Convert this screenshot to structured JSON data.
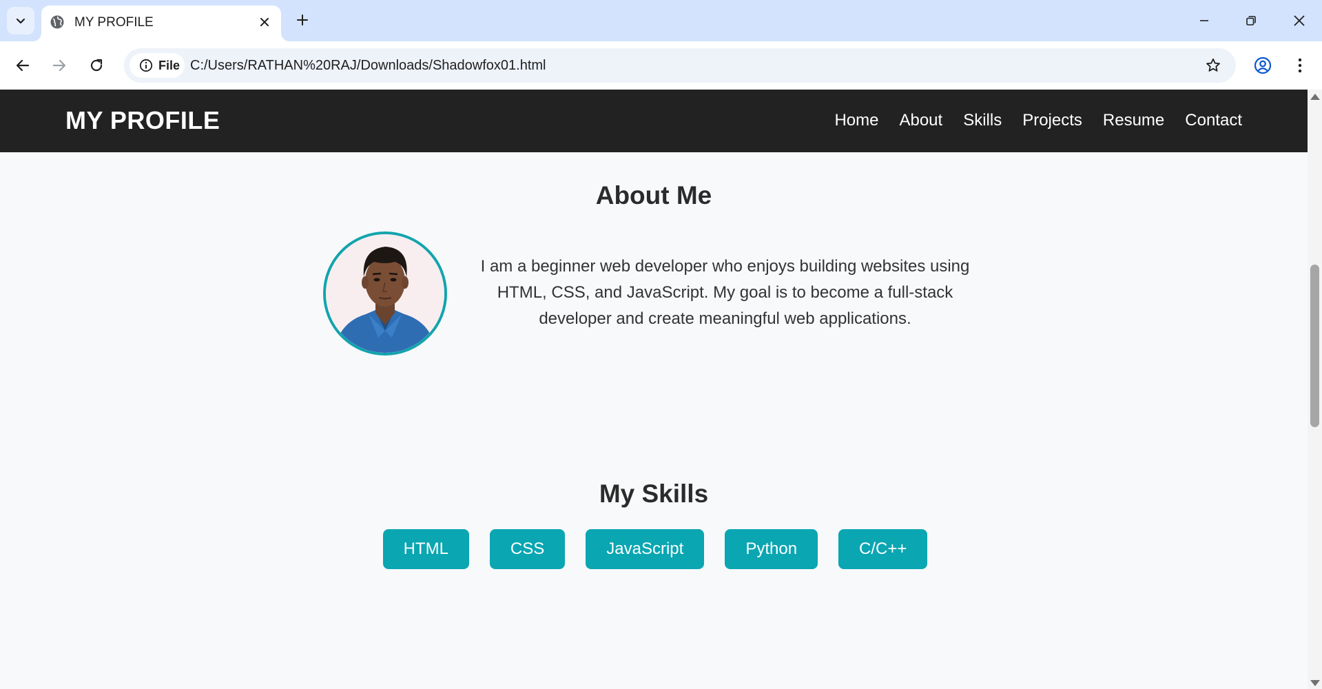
{
  "browser": {
    "tab_title": "MY PROFILE",
    "chip_label": "File",
    "url": "C:/Users/RATHAN%20RAJ/Downloads/Shadowfox01.html",
    "icons": [
      "tab-list-icon",
      "globe-icon",
      "close-icon",
      "plus-icon",
      "minimize-icon",
      "restore-icon",
      "window-close-icon",
      "back-arrow-icon",
      "forward-arrow-icon",
      "reload-icon",
      "info-icon",
      "star-icon",
      "profile-icon",
      "kebab-menu-icon"
    ]
  },
  "site": {
    "logo": "MY PROFILE",
    "nav": [
      "Home",
      "About",
      "Skills",
      "Projects",
      "Resume",
      "Contact"
    ]
  },
  "about": {
    "title": "About Me",
    "text": "I am a beginner web developer who enjoys building websites using HTML, CSS, and JavaScript. My goal is to become a full-stack developer and create meaningful web applications."
  },
  "skills": {
    "title": "My Skills",
    "items": [
      "HTML",
      "CSS",
      "JavaScript",
      "Python",
      "C/C++"
    ]
  },
  "colors": {
    "accent": "#0aa6b2",
    "header_bg": "#222222",
    "page_bg": "#f7f9fb",
    "tabbar_bg": "#d3e3fd"
  }
}
